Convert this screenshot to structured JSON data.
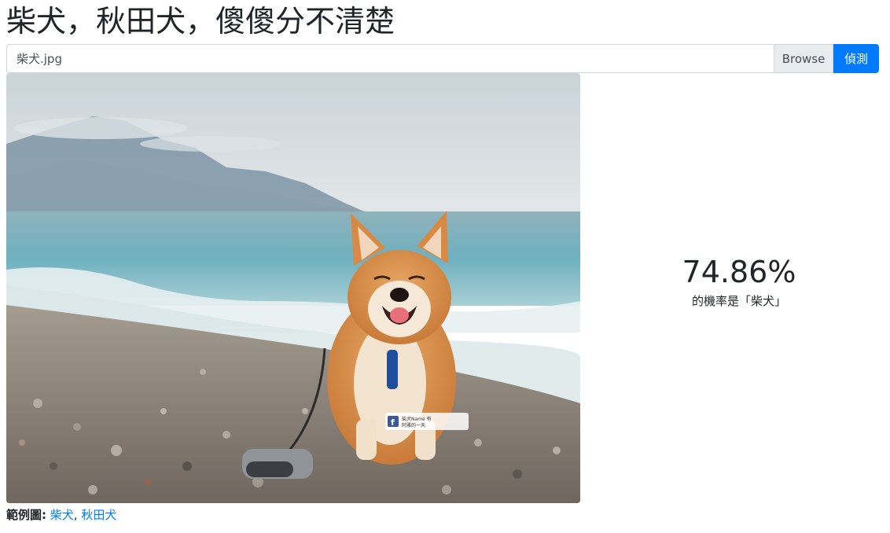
{
  "page": {
    "title": "柴犬，秋田犬，傻傻分不清楚"
  },
  "upload": {
    "file_name": "柴犬.jpg",
    "browse_label": "Browse",
    "detect_label": "偵測"
  },
  "photo": {
    "watermark_text": "柴犬Name 有 阿雅的一天",
    "watermark_icon": "facebook-icon"
  },
  "result": {
    "percent": "74.86%",
    "caption": "的機率是「柴犬」"
  },
  "examples": {
    "label": "範例圖:",
    "links": [
      "柴犬",
      "秋田犬"
    ],
    "separator": ","
  },
  "colors": {
    "primary": "#007bff",
    "link": "#007bff",
    "input_border": "#ced4da",
    "addon_bg": "#e9ecef"
  }
}
